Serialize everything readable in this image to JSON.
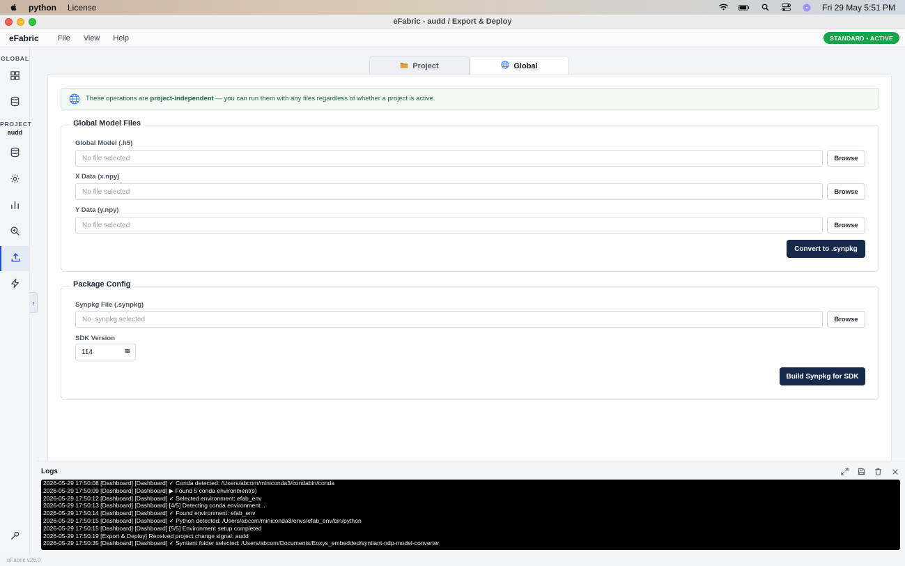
{
  "menubar": {
    "app_name": "python",
    "items": [
      "License"
    ],
    "datetime": "Fri 29 May  5:51 PM"
  },
  "window": {
    "title": "eFabric - audd / Export & Deploy"
  },
  "app": {
    "brand": "eFabric",
    "menus": [
      "File",
      "View",
      "Help"
    ],
    "status": "STANDARD • ACTIVE",
    "version": "eFabric v26.0"
  },
  "sidebar": {
    "global_label": "GLOBAL",
    "project_label": "PROJECT",
    "project_name": "audd",
    "items": [
      {
        "name": "dashboard",
        "icon": "grid-icon"
      },
      {
        "name": "global-data",
        "icon": "database-icon"
      },
      {
        "name": "project-data",
        "icon": "database-icon"
      },
      {
        "name": "settings",
        "icon": "gear-icon"
      },
      {
        "name": "analytics",
        "icon": "bar-chart-icon"
      },
      {
        "name": "inspect",
        "icon": "zoom-icon"
      },
      {
        "name": "export-deploy",
        "icon": "upload-icon"
      },
      {
        "name": "power",
        "icon": "bolt-icon"
      },
      {
        "name": "tools",
        "icon": "wrench-icon"
      }
    ],
    "active": "export-deploy"
  },
  "tabs": [
    {
      "label": "Project",
      "icon": "folder-icon",
      "active": false
    },
    {
      "label": "Global",
      "icon": "globe-icon",
      "active": true
    }
  ],
  "banner": {
    "prefix": "These operations are ",
    "emphasis": "project-independent",
    "suffix": " — you can run them with any files regardless of whether a project is active."
  },
  "global_model_files": {
    "title": "Global Model Files",
    "fields": [
      {
        "label": "Global Model (.h5)",
        "placeholder": "No file selected",
        "button": "Browse"
      },
      {
        "label": "X Data (x.npy)",
        "placeholder": "No file selected",
        "button": "Browse"
      },
      {
        "label": "Y Data (y.npy)",
        "placeholder": "No file selected",
        "button": "Browse"
      }
    ],
    "action": "Convert to .synpkg"
  },
  "package_config": {
    "title": "Package Config",
    "synpkg_label": "Synpkg File (.synpkg)",
    "synpkg_placeholder": "No .synpkg selected",
    "browse": "Browse",
    "sdk_label": "SDK Version",
    "sdk_value": "114",
    "action": "Build Synpkg for SDK"
  },
  "logs": {
    "title": "Logs",
    "lines": [
      "2026-05-29 17:50:08 [Dashboard] [Dashboard] ✓ Conda detected: /Users/abcom/miniconda3/condabin/conda",
      "2026-05-29 17:50:09 [Dashboard] [Dashboard] ▶ Found 5 conda environment(s)",
      "2026-05-29 17:50:12 [Dashboard] [Dashboard] ✓ Selected environment: efab_env",
      "2026-05-29 17:50:13 [Dashboard] [Dashboard] [4/5] Detecting conda environment...",
      "2026-05-29 17:50:14 [Dashboard] [Dashboard] ✓ Found environment: efab_env",
      "2026-05-29 17:50:15 [Dashboard] [Dashboard] ✓ Python detected: /Users/abcom/miniconda3/envs/efab_env/bin/python",
      "2026-05-29 17:50:15 [Dashboard] [Dashboard] [5/5] Environment setup completed",
      "2026-05-29 17:50:19 [Export & Deploy] Received project change signal: audd",
      "2026-05-29 17:50:35 [Dashboard] [Dashboard] ✓ Syntiant folder selected: /Users/abcom/Documents/Eoxys_embedded/syntiant-ndp-model-converter"
    ]
  }
}
